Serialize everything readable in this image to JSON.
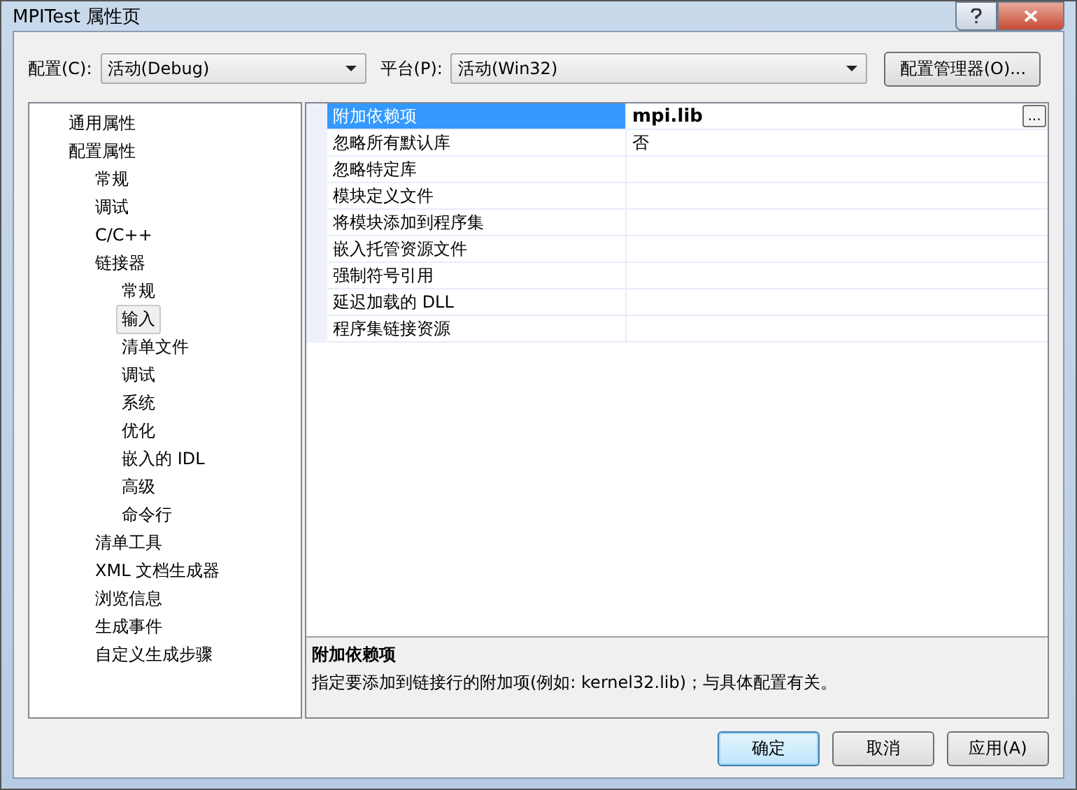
{
  "window": {
    "title": "MPITest 属性页"
  },
  "config": {
    "label": "配置(C):",
    "value": "活动(Debug)"
  },
  "platform": {
    "label": "平台(P):",
    "value": "活动(Win32)"
  },
  "config_manager_button": "配置管理器(O)...",
  "tree": [
    {
      "label": "通用属性",
      "selected": false
    },
    {
      "label": "配置属性",
      "selected": false,
      "children": [
        {
          "label": "常规",
          "selected": false
        },
        {
          "label": "调试",
          "selected": false
        },
        {
          "label": "C/C++",
          "selected": false
        },
        {
          "label": "链接器",
          "selected": false,
          "children": [
            {
              "label": "常规",
              "selected": false
            },
            {
              "label": "输入",
              "selected": true
            },
            {
              "label": "清单文件",
              "selected": false
            },
            {
              "label": "调试",
              "selected": false
            },
            {
              "label": "系统",
              "selected": false
            },
            {
              "label": "优化",
              "selected": false
            },
            {
              "label": "嵌入的 IDL",
              "selected": false
            },
            {
              "label": "高级",
              "selected": false
            },
            {
              "label": "命令行",
              "selected": false
            }
          ]
        },
        {
          "label": "清单工具",
          "selected": false
        },
        {
          "label": "XML 文档生成器",
          "selected": false
        },
        {
          "label": "浏览信息",
          "selected": false
        },
        {
          "label": "生成事件",
          "selected": false
        },
        {
          "label": "自定义生成步骤",
          "selected": false
        }
      ]
    }
  ],
  "properties": [
    {
      "name": "附加依赖项",
      "value": "mpi.lib",
      "modified": true,
      "selected": true
    },
    {
      "name": "忽略所有默认库",
      "value": "否",
      "modified": false,
      "selected": false
    },
    {
      "name": "忽略特定库",
      "selected": false
    },
    {
      "name": "模块定义文件",
      "selected": false
    },
    {
      "name": "将模块添加到程序集",
      "selected": false
    },
    {
      "name": "嵌入托管资源文件",
      "selected": false
    },
    {
      "name": "强制符号引用",
      "selected": false
    },
    {
      "name": "延迟加载的 DLL",
      "selected": false
    },
    {
      "name": "程序集链接资源",
      "selected": false
    }
  ],
  "ellipsis_button": "...",
  "description": {
    "title": "附加依赖项",
    "text": "指定要添加到链接行的附加项(例如: kernel32.lib)；与具体配置有关。"
  },
  "buttons": [
    {
      "label": "确定",
      "default": true
    },
    {
      "label": "取消",
      "default": false
    },
    {
      "label": "应用(A)",
      "default": false
    }
  ]
}
